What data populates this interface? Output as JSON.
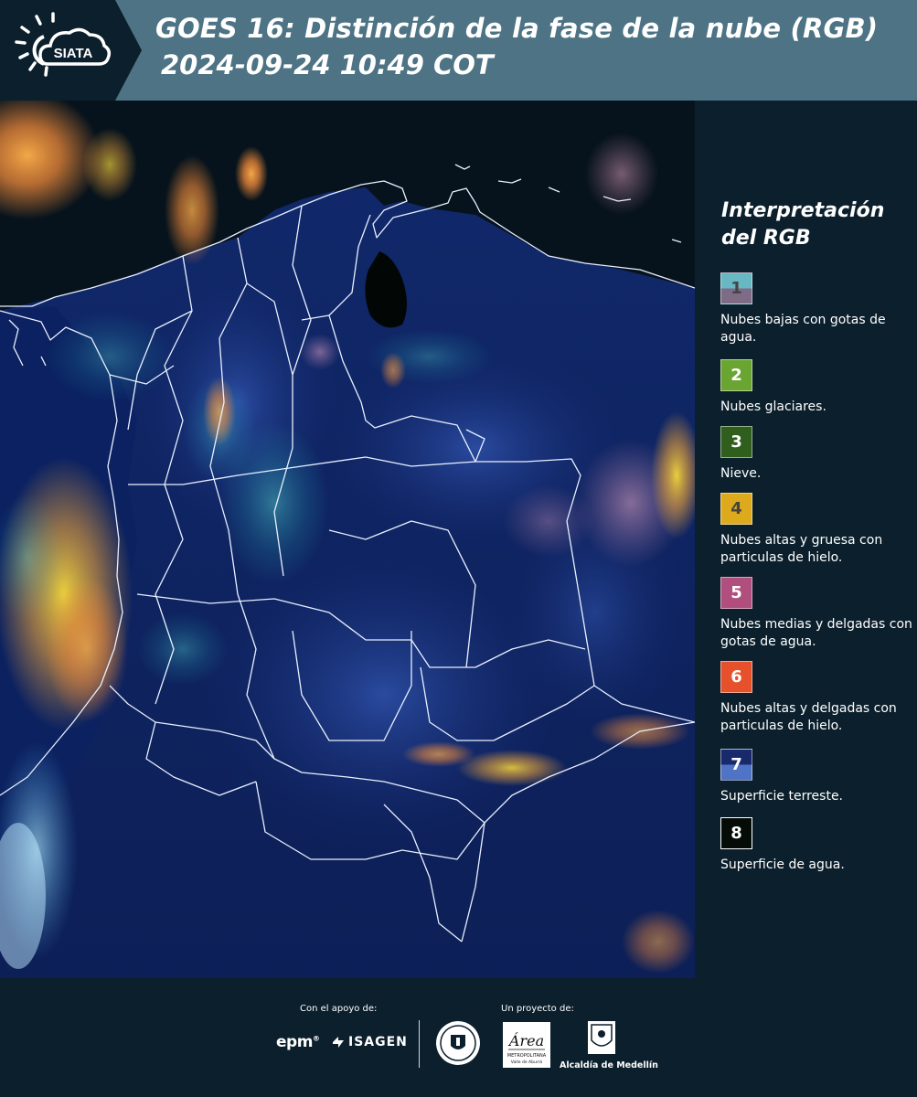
{
  "header": {
    "logo_text": "SIATA",
    "title_line1": "GOES 16: Distinción de la fase de la nube (RGB)",
    "title_line2": "2024-09-24 10:49 COT"
  },
  "legend": {
    "title_line1": "Interpretación",
    "title_line2": "del RGB",
    "items": [
      {
        "num": "1",
        "label": "Nubes bajas con gotas de agua.",
        "top": "#68b8c4",
        "bottom": "#7e6b86",
        "num_color": "#444444"
      },
      {
        "num": "2",
        "label": "Nubes glaciares.",
        "top": "#6aa532",
        "bottom": "#6aa532",
        "num_color": "#ffffff"
      },
      {
        "num": "3",
        "label": "Nieve.",
        "top": "#2f5e1d",
        "bottom": "#2f5e1d",
        "num_color": "#ffffff"
      },
      {
        "num": "4",
        "label": "Nubes altas y gruesa con particulas de hielo.",
        "top": "#dcaa1c",
        "bottom": "#dcaa1c",
        "num_color": "#444444"
      },
      {
        "num": "5",
        "label": "Nubes medias y delgadas con gotas de agua.",
        "top": "#b04f7e",
        "bottom": "#b04f7e",
        "num_color": "#ffffff"
      },
      {
        "num": "6",
        "label": "Nubes altas y delgadas con particulas de hielo.",
        "top": "#e6512b",
        "bottom": "#e6512b",
        "num_color": "#ffffff"
      },
      {
        "num": "7",
        "label": "Superficie terreste.",
        "top": "#182a6c",
        "bottom": "#4f74c5",
        "num_color": "#ffffff"
      },
      {
        "num": "8",
        "label": "Superficie de agua.",
        "top": "#050c06",
        "bottom": "#050c06",
        "num_color": "#ffffff"
      }
    ]
  },
  "footer": {
    "support_label": "Con el apoyo de:",
    "project_label": "Un proyecto de:",
    "epm": "epm",
    "isagen": "ISAGEN",
    "area_text": "Área",
    "area_sub1": "METROPOLITANA",
    "area_sub2": "Valle de Aburrá",
    "alcaldia": "Alcaldía de Medellín"
  }
}
